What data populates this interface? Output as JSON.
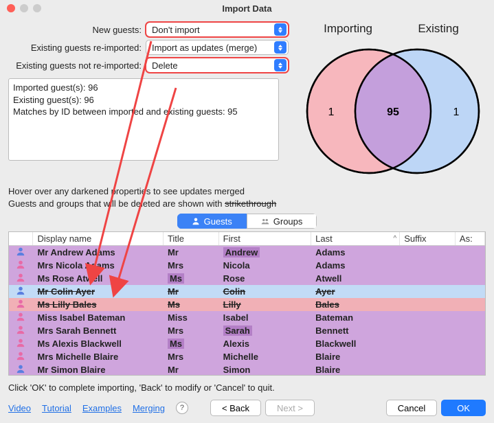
{
  "window": {
    "title": "Import Data"
  },
  "venn_labels": {
    "left": "Importing",
    "right": "Existing"
  },
  "form": {
    "new_guests_label": "New guests:",
    "new_guests_value": "Don't import",
    "existing_reimported_label": "Existing guests re-imported:",
    "existing_reimported_value": "Import as updates (merge)",
    "existing_not_reimported_label": "Existing guests not re-imported:",
    "existing_not_reimported_value": "Delete"
  },
  "stats": {
    "l1": "Imported guest(s): 96",
    "l2": "Existing guest(s): 96",
    "l3": "Matches by ID between imported and existing guests: 95"
  },
  "chart_data": {
    "type": "venn",
    "sets": [
      {
        "name": "Importing",
        "only": 1,
        "color": "#f7b7bd"
      },
      {
        "name": "Existing",
        "only": 1,
        "color": "#bdd6f6"
      }
    ],
    "intersection": 95,
    "intersection_color": "#c49fdc"
  },
  "hint": {
    "line1": "Hover over any darkened properties to see updates merged",
    "line2a": "Guests and groups that will be deleted are shown with ",
    "line2b": "strikethrough"
  },
  "tabs": {
    "guests": "Guests",
    "groups": "Groups"
  },
  "columns": {
    "display": "Display name",
    "title": "Title",
    "first": "First",
    "last": "Last",
    "suffix": "Suffix",
    "ass": "As:"
  },
  "rows": [
    {
      "icon": "blue",
      "display": "Mr Andrew Adams",
      "title": "Mr",
      "first": "Andrew",
      "first_hl": true,
      "last": "Adams",
      "style": "purple",
      "bold": true
    },
    {
      "icon": "pink",
      "display": "Mrs Nicola Adams",
      "title": "Mrs",
      "first": "Nicola",
      "last": "Adams",
      "style": "purple",
      "bold": true
    },
    {
      "icon": "pink",
      "display": "Ms Rose Atwell",
      "title": "Ms",
      "title_hl": true,
      "first": "Rose",
      "last": "Atwell",
      "style": "purple",
      "bold": true
    },
    {
      "icon": "blue",
      "display": "Mr Colin Ayer",
      "title": "Mr",
      "first": "Colin",
      "last": "Ayer",
      "style": "blue",
      "strike": true
    },
    {
      "icon": "pink",
      "display": "Ms Lilly Bales",
      "title": "Ms",
      "first": "Lilly",
      "last": "Bales",
      "style": "pink",
      "strike": true
    },
    {
      "icon": "pink",
      "display": "Miss Isabel Bateman",
      "title": "Miss",
      "first": "Isabel",
      "last": "Bateman",
      "style": "purple",
      "bold": true
    },
    {
      "icon": "pink",
      "display": "Mrs Sarah Bennett",
      "title": "Mrs",
      "first": "Sarah",
      "first_hl": true,
      "last": "Bennett",
      "style": "purple",
      "bold": true
    },
    {
      "icon": "pink",
      "display": "Ms Alexis Blackwell",
      "title": "Ms",
      "title_hl": true,
      "first": "Alexis",
      "last": "Blackwell",
      "style": "purple",
      "bold": true
    },
    {
      "icon": "pink",
      "display": "Mrs Michelle Blaire",
      "title": "Mrs",
      "first": "Michelle",
      "last": "Blaire",
      "style": "purple",
      "bold": true
    },
    {
      "icon": "blue",
      "display": "Mr Simon Blaire",
      "title": "Mr",
      "first": "Simon",
      "last": "Blaire",
      "style": "purple",
      "bold": true
    }
  ],
  "footer": {
    "note": "Click 'OK' to complete importing, 'Back' to modify or 'Cancel' to quit.",
    "video": "Video",
    "tutorial": "Tutorial",
    "examples": "Examples",
    "merging": "Merging",
    "help": "?",
    "back": "< Back",
    "next": "Next >",
    "cancel": "Cancel",
    "ok": "OK"
  }
}
